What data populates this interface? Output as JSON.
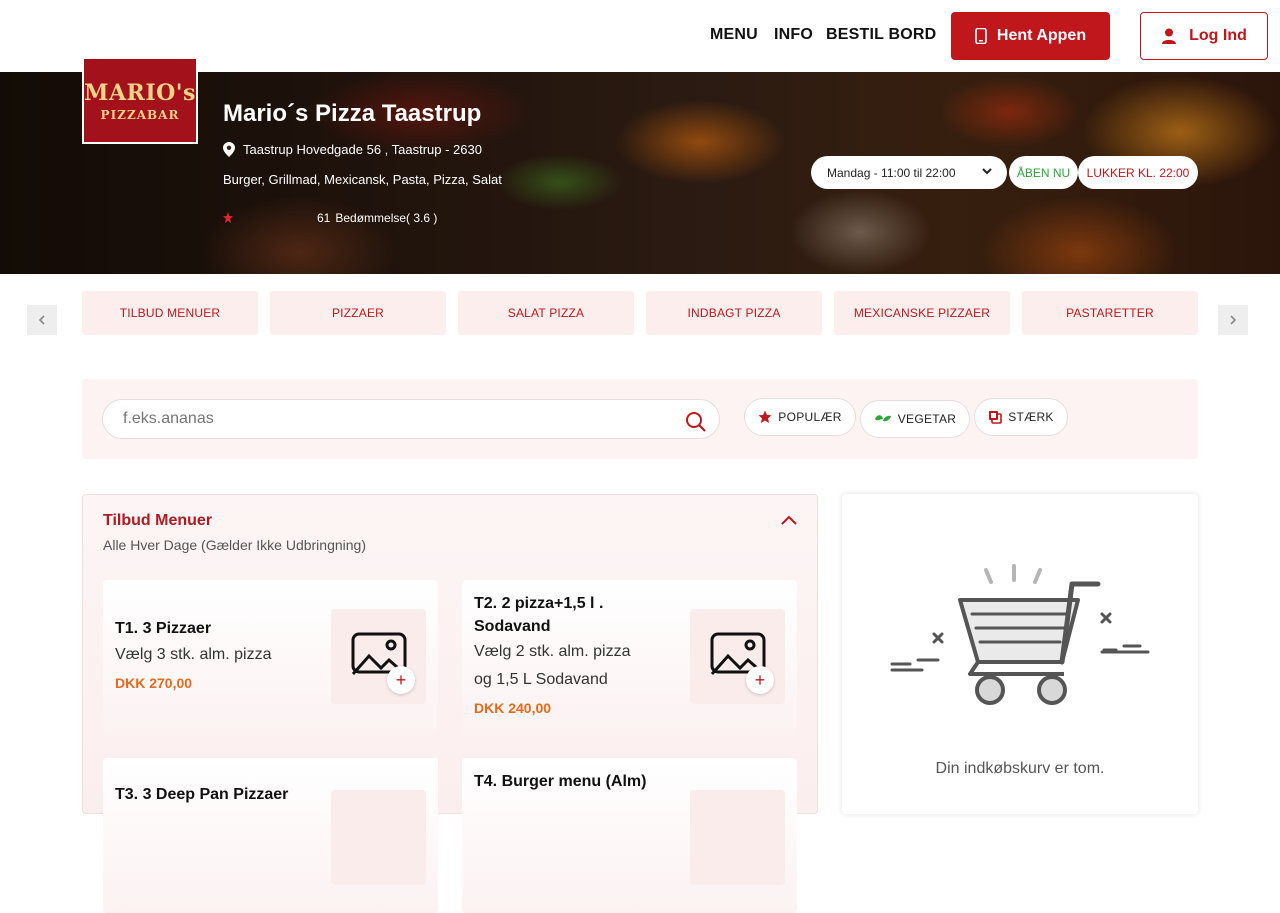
{
  "header": {
    "nav": [
      "MENU",
      "INFO",
      "BESTIL BORD"
    ],
    "app_button": "Hent Appen",
    "login_button": "Log Ind"
  },
  "restaurant": {
    "logo_main": "MARIO's",
    "logo_sub": "PIZZABAR",
    "name": "Mario´s Pizza Taastrup",
    "address": "Taastrup Hovedgade 56 , Taastrup - 2630",
    "cuisines": "Burger, Grillmad, Mexicansk, Pasta, Pizza, Salat",
    "rating_count": "61",
    "rating_text": "Bedømmelse( 3.6 )",
    "rating_value": 3.6,
    "hours_selected": "Mandag - 11:00 til 22:00",
    "status_open": "ÅBEN NU",
    "status_close": "LUKKER KL. 22:00"
  },
  "categories": [
    "TILBUD MENUER",
    "PIZZAER",
    "SALAT PIZZA",
    "INDBAGT PIZZA",
    "MEXICANSKE PIZZAER",
    "PASTARETTER"
  ],
  "search": {
    "placeholder": "f.eks.ananas",
    "filters": [
      "POPULÆR",
      "VEGETAR",
      "STÆRK"
    ]
  },
  "menu_section": {
    "title": "Tilbud Menuer",
    "subtitle": "Alle Hver Dage (Gælder Ikke Udbringning)",
    "items": [
      {
        "title": "T1. 3 Pizzaer",
        "desc": "Vælg 3 stk. alm. pizza",
        "price": "DKK 270,00"
      },
      {
        "title_line1": "T2. 2 pizza+1,5 l .",
        "title_line2": "Sodavand",
        "desc_line1": "Vælg 2 stk. alm. pizza",
        "desc_line2": "og 1,5 L Sodavand",
        "price": "DKK 240,00"
      },
      {
        "title": "T3. 3 Deep Pan Pizzaer"
      },
      {
        "title": "T4. Burger menu (Alm)"
      }
    ]
  },
  "cart": {
    "empty_text": "Din indkøbskurv er tom."
  },
  "colors": {
    "brand_red": "#c0171c",
    "price_orange": "#e46a1c",
    "open_green": "#2aa63a"
  }
}
